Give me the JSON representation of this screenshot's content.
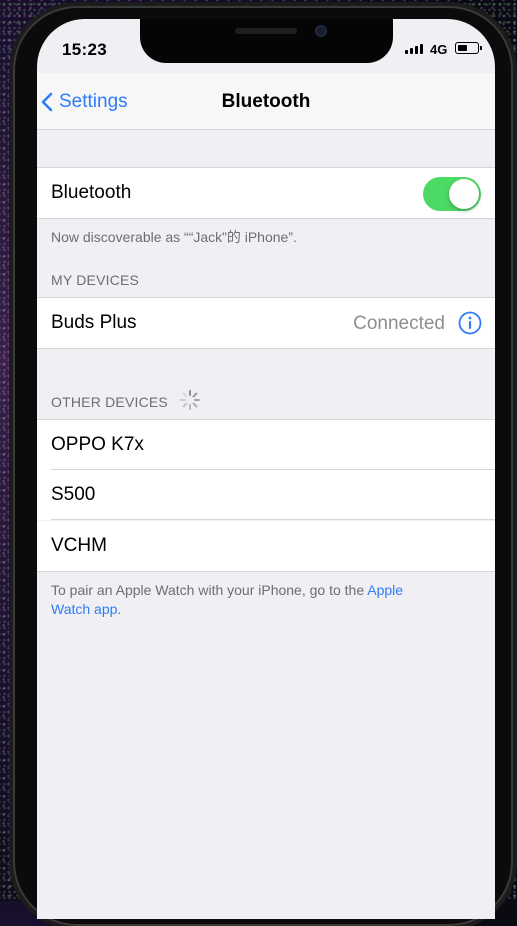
{
  "status_bar": {
    "time": "15:23",
    "network": "4G"
  },
  "nav": {
    "back_label": "Settings",
    "title": "Bluetooth"
  },
  "bluetooth_row": {
    "label": "Bluetooth",
    "enabled": true
  },
  "discoverable_note": "Now discoverable as ““Jack”的 iPhone”.",
  "my_devices": {
    "header": "MY DEVICES",
    "items": [
      {
        "name": "Buds Plus",
        "status": "Connected"
      }
    ]
  },
  "other_devices": {
    "header": "OTHER DEVICES",
    "items": [
      {
        "name": "OPPO K7x"
      },
      {
        "name": "S500"
      },
      {
        "name": "VCHM"
      }
    ]
  },
  "footer": {
    "text": "To pair an Apple Watch with your iPhone, go to the ",
    "link_part1": "Apple",
    "link_part2": "Watch app",
    "end": "."
  },
  "colors": {
    "accent": "#2f7cf6",
    "toggle_on": "#4cd964",
    "background": "#efeff4"
  },
  "icons": [
    "chevron-left-icon",
    "info-icon",
    "spinner-icon",
    "signal-icon",
    "battery-icon"
  ]
}
